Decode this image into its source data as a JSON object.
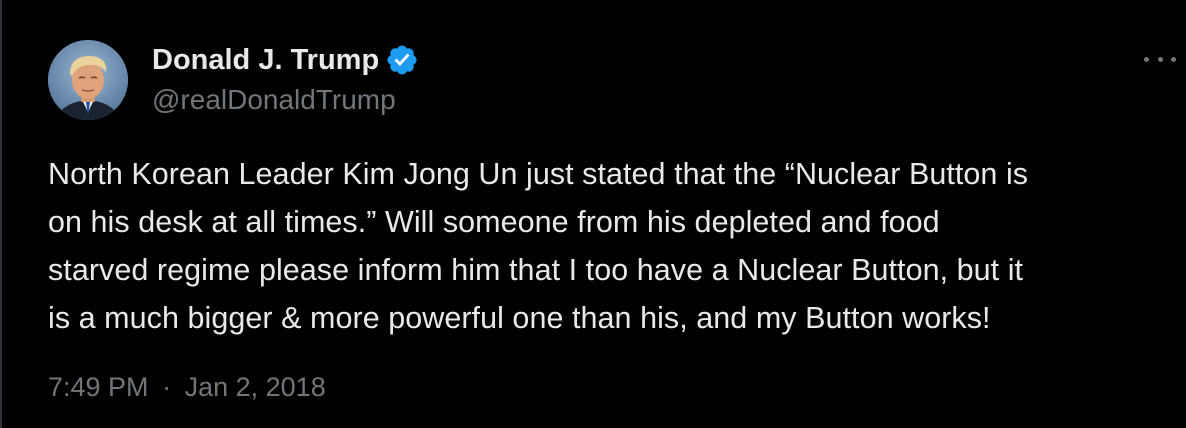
{
  "author": {
    "display_name": "Donald J. Trump",
    "handle": "@realDonaldTrump",
    "verified": true,
    "verified_badge_color": "#1d9bf0",
    "avatar_icon": "profile-photo"
  },
  "tweet": {
    "text": "North Korean Leader Kim Jong Un just stated that the “Nuclear Button is\non his desk at all times.” Will someone from his depleted and food\nstarved regime please inform him that I too have a Nuclear Button, but it\nis a much bigger & more powerful one than his, and my Button works!",
    "time": "7:49 PM",
    "separator": "·",
    "date": "Jan 2, 2018"
  },
  "menu": {
    "icon": "more-horizontal-icon"
  },
  "colors": {
    "background": "#000000",
    "primary_text": "#e7e9ea",
    "secondary_text": "#71767b",
    "accent": "#1d9bf0"
  }
}
